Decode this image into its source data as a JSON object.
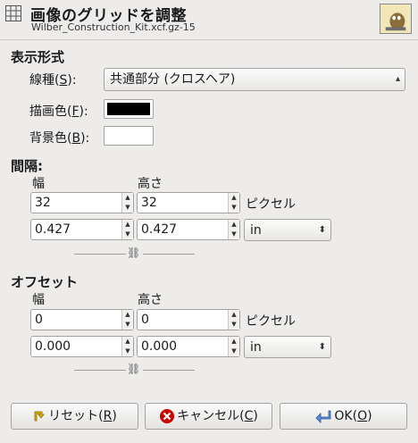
{
  "header": {
    "title": "画像のグリッドを調整",
    "subtitle": "Wilber_Construction_Kit.xcf.gz-15"
  },
  "display": {
    "section": "表示形式",
    "line_style_label_pre": "線種(",
    "line_style_mnemonic": "S",
    "line_style_label_post": "):",
    "line_style_value": "共通部分 (クロスヘア)",
    "fg_label_pre": "描画色(",
    "fg_mnemonic": "F",
    "fg_label_post": "):",
    "fg_color": "#000000",
    "bg_label_pre": "背景色(",
    "bg_mnemonic": "B",
    "bg_label_post": "):",
    "bg_color": "#ffffff"
  },
  "spacing": {
    "section": "間隔:",
    "width_label": "幅",
    "height_label": "高さ",
    "width_px": "32",
    "height_px": "32",
    "unit_px": "ピクセル",
    "width_in": "0.427",
    "height_in": "0.427",
    "unit_select": "in"
  },
  "offset": {
    "section": "オフセット",
    "width_label": "幅",
    "height_label": "高さ",
    "x_px": "0",
    "y_px": "0",
    "unit_px": "ピクセル",
    "x_in": "0.000",
    "y_in": "0.000",
    "unit_select": "in"
  },
  "buttons": {
    "reset_pre": "リセット(",
    "reset_mnemonic": "R",
    "reset_post": ")",
    "cancel_pre": "キャンセル(",
    "cancel_mnemonic": "C",
    "cancel_post": ")",
    "ok_pre": "OK(",
    "ok_mnemonic": "O",
    "ok_post": ")"
  },
  "icons": {
    "grid": "grid-icon",
    "thumbnail": "image-thumbnail",
    "chain": "chain-link-icon",
    "reset": "reset-icon",
    "cancel": "cancel-icon",
    "ok": "ok-arrow-icon"
  },
  "colors": {
    "cancel_red": "#cc0000",
    "reset_yellow": "#e8b800"
  }
}
